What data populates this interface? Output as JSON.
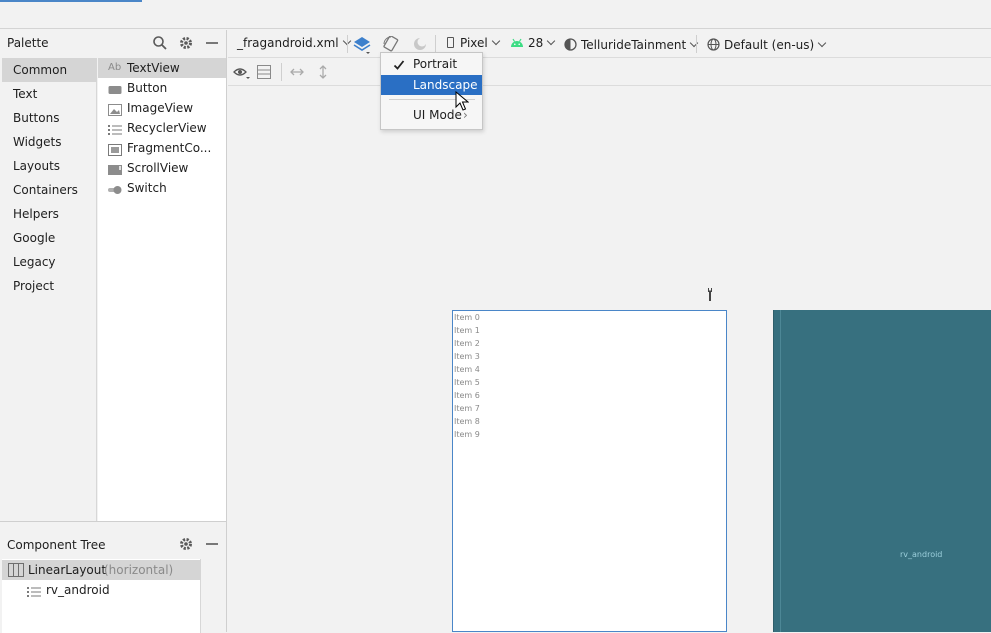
{
  "palette": {
    "title": "Palette",
    "categories": [
      "Common",
      "Text",
      "Buttons",
      "Widgets",
      "Layouts",
      "Containers",
      "Helpers",
      "Google",
      "Legacy",
      "Project"
    ],
    "components": [
      {
        "label": "TextView",
        "prefix": "Ab",
        "icon": "textview-icon"
      },
      {
        "label": "Button",
        "icon": "button-icon"
      },
      {
        "label": "ImageView",
        "icon": "imageview-icon"
      },
      {
        "label": "RecyclerView",
        "icon": "list-icon"
      },
      {
        "label": "FragmentCo...",
        "icon": "fragment-icon"
      },
      {
        "label": "ScrollView",
        "icon": "scrollview-icon"
      },
      {
        "label": "Switch",
        "icon": "switch-icon"
      }
    ]
  },
  "component_tree": {
    "title": "Component Tree",
    "root": {
      "label": "LinearLayout",
      "hint": "(horizontal)"
    },
    "child": {
      "label": "rv_android"
    }
  },
  "toolbar": {
    "file": "_fragandroid.xml",
    "device": "Pixel",
    "api": "28",
    "theme": "TellurideTainment",
    "locale": "Default (en-us)"
  },
  "orientation_menu": {
    "items": [
      "Portrait",
      "Landscape",
      "UI Mode"
    ],
    "checked": "Portrait",
    "highlighted": "Landscape"
  },
  "preview": {
    "items": [
      "Item 0",
      "Item 1",
      "Item 2",
      "Item 3",
      "Item 4",
      "Item 5",
      "Item 6",
      "Item 7",
      "Item 8",
      "Item 9"
    ],
    "blueprint_label": "rv_android"
  },
  "colors": {
    "accent": "#4a86c8",
    "menu_highlight": "#2a6fc4",
    "blueprint": "#37707f",
    "android_green": "#3ddc84"
  }
}
